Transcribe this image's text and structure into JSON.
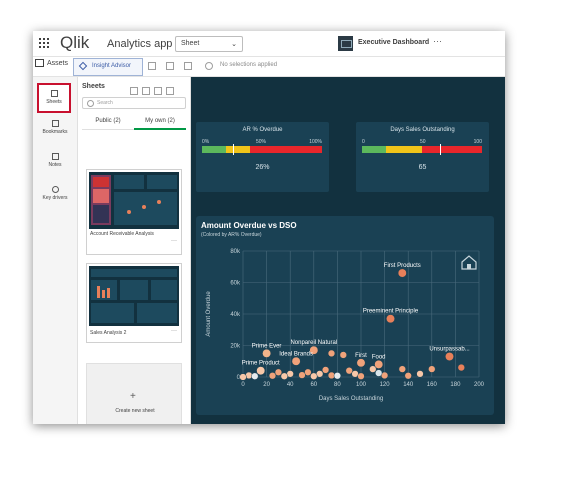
{
  "topbar": {
    "logo": "Qlik",
    "app_title": "Analytics app",
    "sheet_dropdown": "Sheet",
    "sheet_name": "Executive Dashboard"
  },
  "toolbar": {
    "assets": "Assets",
    "insight_advisor": "Insight Advisor",
    "no_selections": "No selections applied"
  },
  "rail": {
    "sheets": "Sheets",
    "bookmarks": "Bookmarks",
    "notes": "Notes",
    "key_drivers": "Key drivers"
  },
  "sheet_panel": {
    "title": "Sheets",
    "search_placeholder": "Search",
    "tabs": [
      "Public (2)",
      "My own (2)"
    ],
    "cards": [
      "Account Receivable Analysis",
      "Sales Analysis 2"
    ],
    "create_new": "Create new sheet"
  },
  "kpis": [
    {
      "title": "AR % Overdue",
      "ticks": [
        "0%",
        "50%",
        "100%"
      ],
      "value": "26%",
      "marker": 0.26,
      "bands": [
        {
          "from": 0,
          "to": 0.2,
          "color": "#5cb85c"
        },
        {
          "from": 0.2,
          "to": 0.4,
          "color": "#f0c419"
        },
        {
          "from": 0.4,
          "to": 1,
          "color": "#e8262b"
        }
      ]
    },
    {
      "title": "Days Sales Outstanding",
      "ticks": [
        "0",
        "50",
        "100"
      ],
      "value": "65",
      "marker": 0.65,
      "bands": [
        {
          "from": 0,
          "to": 0.2,
          "color": "#5cb85c"
        },
        {
          "from": 0.2,
          "to": 0.5,
          "color": "#f0c419"
        },
        {
          "from": 0.5,
          "to": 1,
          "color": "#e8262b"
        }
      ]
    }
  ],
  "colors": {
    "canvas": "#12313f",
    "panel": "#1a4154",
    "accent_green": "#009845",
    "highlight_red": "#c8102e",
    "bubble": "#f0a27a"
  },
  "chart_data": {
    "type": "scatter",
    "title": "Amount Overdue vs DSO",
    "subtitle": "(Colored by AR% Overdue)",
    "xlabel": "Days Sales Outstanding",
    "ylabel": "Amount Overdue",
    "xlim": [
      0,
      200
    ],
    "ylim": [
      0,
      80000
    ],
    "xticks": [
      0,
      20,
      40,
      60,
      80,
      100,
      120,
      140,
      160,
      180,
      200
    ],
    "yticks": [
      0,
      20000,
      40000,
      60000,
      80000
    ],
    "ytick_labels": [
      "0",
      "20k",
      "40k",
      "60k",
      "80k"
    ],
    "grid": true,
    "points": [
      {
        "x": 135,
        "y": 66000,
        "label": "First Products",
        "color": "#e8805a"
      },
      {
        "x": 125,
        "y": 37000,
        "label": "Preeminent Principle",
        "color": "#e8805a"
      },
      {
        "x": 20,
        "y": 15000,
        "label": "Prime Ever",
        "color": "#f2b48a"
      },
      {
        "x": 60,
        "y": 17000,
        "label": "Nonpareil Natural",
        "color": "#f0a27a"
      },
      {
        "x": 75,
        "y": 15000,
        "label": "",
        "color": "#f0a27a"
      },
      {
        "x": 85,
        "y": 14000,
        "label": "",
        "color": "#f0a27a"
      },
      {
        "x": 45,
        "y": 10000,
        "label": "Ideal Brands",
        "color": "#f0a27a"
      },
      {
        "x": 100,
        "y": 9000,
        "label": "First",
        "color": "#f0a27a"
      },
      {
        "x": 115,
        "y": 8000,
        "label": "Food",
        "color": "#f0a27a"
      },
      {
        "x": 175,
        "y": 13000,
        "label": "Unsurpassab...",
        "color": "#e8805a"
      },
      {
        "x": 185,
        "y": 6000,
        "label": "",
        "color": "#e8805a"
      },
      {
        "x": 160,
        "y": 5000,
        "label": "",
        "color": "#f0a27a"
      },
      {
        "x": 135,
        "y": 5000,
        "label": "",
        "color": "#f0a27a"
      },
      {
        "x": 110,
        "y": 5000,
        "label": "",
        "color": "#f7c7a8"
      },
      {
        "x": 90,
        "y": 4000,
        "label": "",
        "color": "#f0a27a"
      },
      {
        "x": 15,
        "y": 4000,
        "label": "Prime Product",
        "color": "#f7c7a8"
      },
      {
        "x": 30,
        "y": 3000,
        "label": "",
        "color": "#f0a27a"
      },
      {
        "x": 40,
        "y": 2000,
        "label": "",
        "color": "#f7c7a8"
      },
      {
        "x": 55,
        "y": 3000,
        "label": "",
        "color": "#f0a27a"
      },
      {
        "x": 65,
        "y": 2000,
        "label": "",
        "color": "#f7c7a8"
      },
      {
        "x": 75,
        "y": 1000,
        "label": "",
        "color": "#f0a27a"
      },
      {
        "x": 95,
        "y": 2000,
        "label": "",
        "color": "#f7c7a8"
      },
      {
        "x": 120,
        "y": 1000,
        "label": "",
        "color": "#f0a27a"
      },
      {
        "x": 150,
        "y": 2000,
        "label": "",
        "color": "#f7c7a8"
      },
      {
        "x": 5,
        "y": 1000,
        "label": "",
        "color": "#f7c7a8"
      },
      {
        "x": 10,
        "y": 500,
        "label": "",
        "color": "#e6ebee"
      },
      {
        "x": 25,
        "y": 800,
        "label": "",
        "color": "#f0a27a"
      },
      {
        "x": 35,
        "y": 500,
        "label": "",
        "color": "#f7c7a8"
      },
      {
        "x": 50,
        "y": 1200,
        "label": "",
        "color": "#f0a27a"
      },
      {
        "x": 60,
        "y": 500,
        "label": "",
        "color": "#f7c7a8"
      },
      {
        "x": 70,
        "y": 4500,
        "label": "",
        "color": "#f0a27a"
      },
      {
        "x": 80,
        "y": 800,
        "label": "",
        "color": "#e6ebee"
      },
      {
        "x": 100,
        "y": 500,
        "label": "",
        "color": "#f0a27a"
      },
      {
        "x": 115,
        "y": 2500,
        "label": "",
        "color": "#d7e4ea"
      },
      {
        "x": 140,
        "y": 800,
        "label": "",
        "color": "#f0a27a"
      },
      {
        "x": 0,
        "y": 0,
        "label": "",
        "color": "#f7c7a8"
      }
    ]
  }
}
